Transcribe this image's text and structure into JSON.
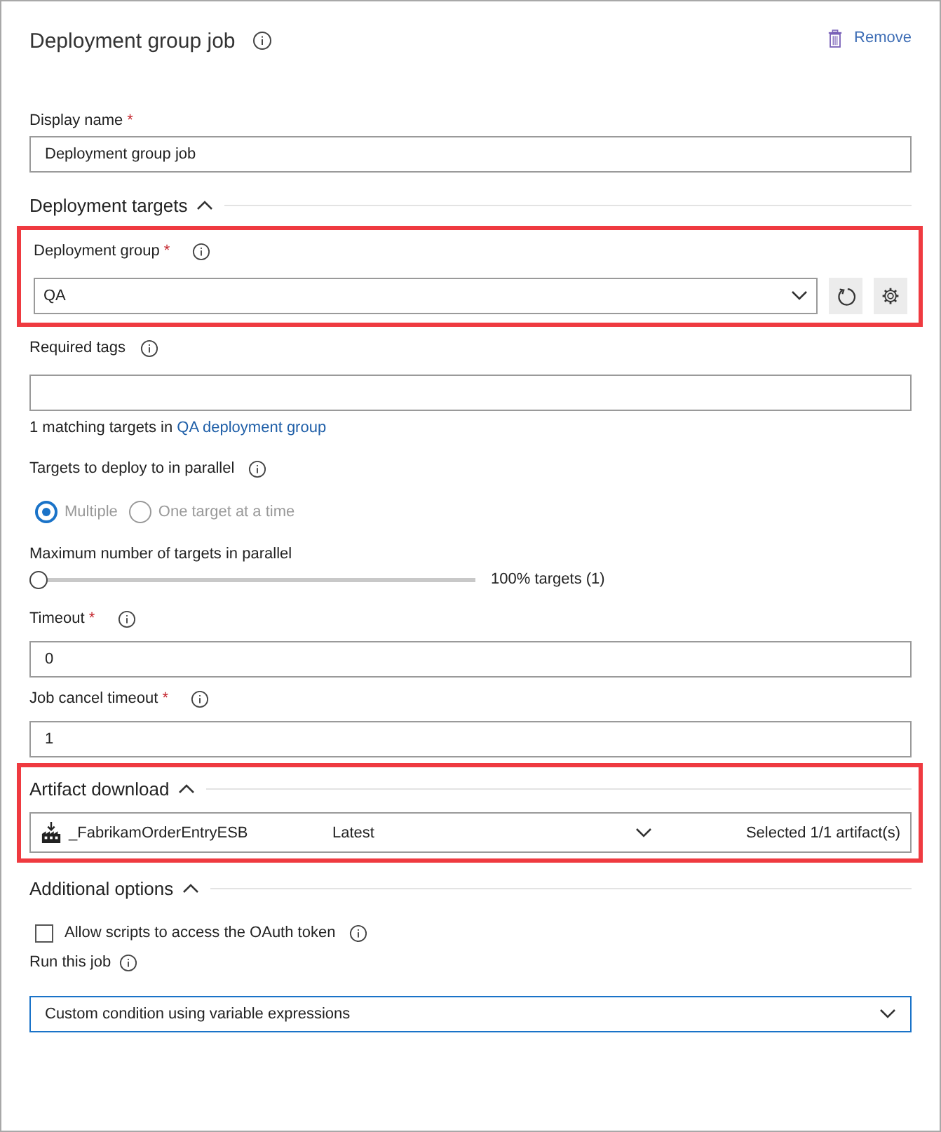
{
  "title": "Deployment group job",
  "remove": "Remove",
  "display_name": {
    "label": "Display name",
    "required_mark": "*",
    "value": "Deployment group job"
  },
  "deployment_targets": {
    "heading": "Deployment targets",
    "expanded": true
  },
  "deployment_group": {
    "label": "Deployment group",
    "required_mark": "*",
    "value": "QA",
    "highlighted": true
  },
  "required_tags": {
    "label": "Required tags"
  },
  "matching": {
    "text": "1 matching targets in ",
    "link": "QA deployment group"
  },
  "parallel": {
    "label": "Targets to deploy to in parallel",
    "options": [
      {
        "label": "Multiple",
        "selected": true,
        "disabled": true
      },
      {
        "label": "One target at a time",
        "selected": false,
        "disabled": true
      }
    ]
  },
  "max_targets": {
    "label": "Maximum number of targets in parallel",
    "level": 0,
    "reading": "100% targets (1)"
  },
  "timeout": {
    "label": "Timeout",
    "required_mark": "*",
    "value": "0"
  },
  "cancel_timeout": {
    "label": "Job cancel timeout",
    "required_mark": "*",
    "value": "1"
  },
  "artifact_download": {
    "heading": "Artifact download",
    "expanded": true,
    "highlighted": true,
    "artifact": {
      "name": "_FabrikamOrderEntryESB",
      "version": "Latest",
      "selection": "Selected 1/1 artifact(s)"
    }
  },
  "additional_options": {
    "heading": "Additional options",
    "expanded": true,
    "oauth": {
      "label": "Allow scripts to access the OAuth token",
      "checked": false
    },
    "run_label": "Run this job",
    "run_value": "Custom condition using variable expressions"
  }
}
